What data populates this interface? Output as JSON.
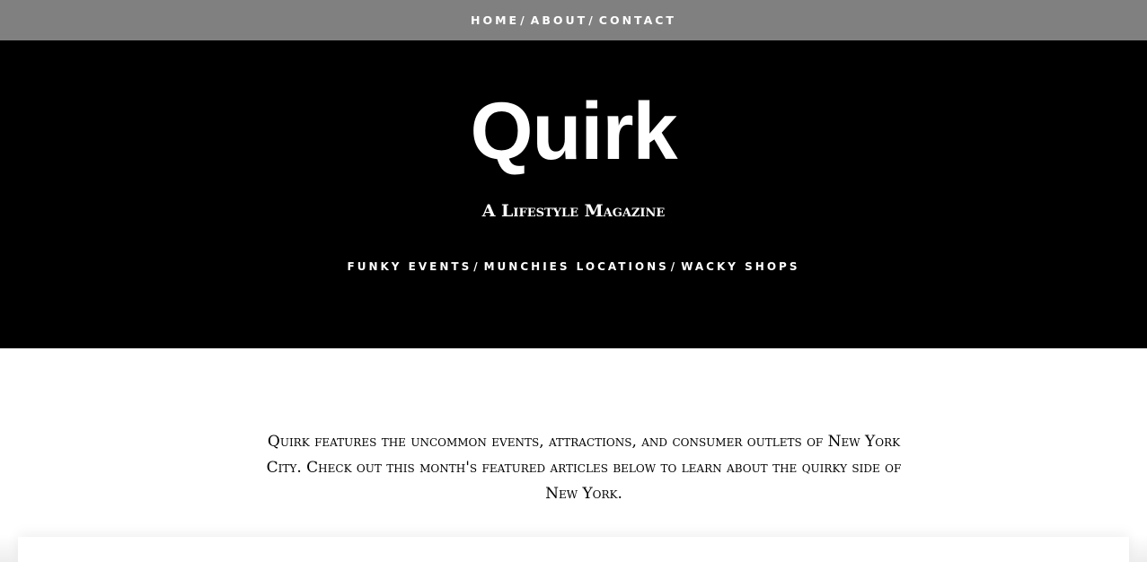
{
  "top_nav": {
    "items": [
      {
        "label": "HOME"
      },
      {
        "label": "ABOUT"
      },
      {
        "label": "CONTACT"
      }
    ],
    "separator": "/"
  },
  "hero": {
    "title": "Quirk",
    "subtitle": "A Lifestyle Magazine",
    "sections": [
      {
        "label": "FUNKY EVENTS"
      },
      {
        "label": "MUNCHIES LOCATIONS"
      },
      {
        "label": "WACKY SHOPS"
      }
    ],
    "separator": "/"
  },
  "intro": {
    "text": "Quirk features the uncommon events, attractions, and consumer outlets of New York City. Check out this month's featured articles below to learn about the quirky side of New York."
  },
  "colors": {
    "nav_background": "#808080",
    "hero_background": "#000000",
    "page_background": "#ffffff",
    "text_light": "#ffffff",
    "text_dark": "#000000"
  }
}
